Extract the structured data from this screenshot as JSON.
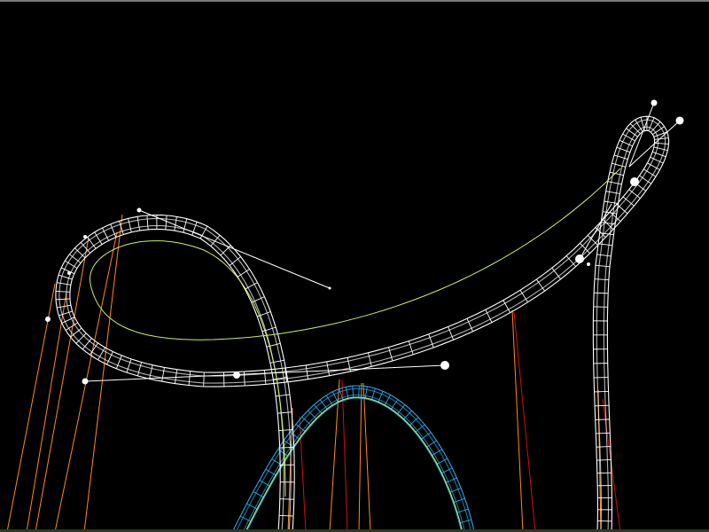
{
  "scene": {
    "background": "#000000",
    "colors": {
      "selected_track": "#ffffff",
      "unselected_track": "#29a8e6",
      "spine": "#c8f06a",
      "support_primary": "#ff8a1e",
      "support_secondary": "#d01010",
      "handle": "#ffffff",
      "ground": "#2f3a1c",
      "toolbar_edge": "#7a7a7a"
    },
    "icons": {
      "control_point": "circle",
      "handle_line": "line"
    }
  }
}
